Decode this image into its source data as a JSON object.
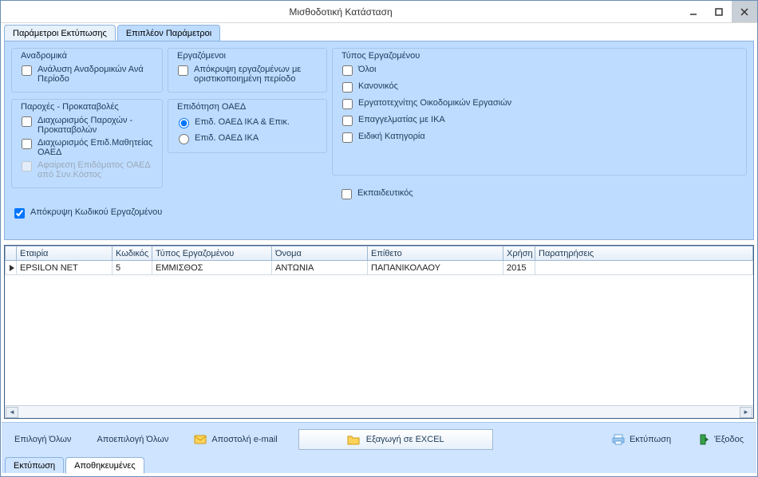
{
  "window": {
    "title": "Μισθοδοτική Κατάσταση"
  },
  "topTabs": {
    "t1": "Παράμετροι Εκτύπωσης",
    "t2": "Επιπλέον Παράμετροι"
  },
  "sections": {
    "anadromika": {
      "legend": "Αναδρομικά",
      "analysisPerPeriod": "Ανάλυση Αναδρομικών Ανά Περίοδο"
    },
    "paroxes": {
      "legend": "Παροχές - Προκαταβολές",
      "separationParoxon": "Διαχωρισμός Παροχών - Προκαταβολών",
      "separationOAED": "Διαχωρισμός Επιδ.Μαθητείας ΟΑΕΔ",
      "removeOAED": "Αφαίρεση Επιδόματος ΟΑΕΔ από Συν.Κόστος"
    },
    "hideCode": "Απόκρυψη Κωδικού Εργαζομένου",
    "ergazomenoi": {
      "legend": "Εργαζόμενοι",
      "hideFinalized": "Απόκρυψη εργαζομένων με οριστικοποιημένη περίοδο"
    },
    "epidotisi": {
      "legend": "Επιδότηση ΟΑΕΔ",
      "r1": "Επιδ. ΟΑΕΔ ΙΚΑ & Επικ.",
      "r2": "Επιδ. ΟΑΕΔ ΙΚΑ"
    },
    "typos": {
      "legend": "Τύπος Εργαζομένου",
      "all": "Όλοι",
      "kanonikos": "Κανονικός",
      "oikodomikon": "Εργατοτεχνίτης Οικοδομικών Εργασιών",
      "epangelmatias": "Επαγγελματίας με ΙΚΑ",
      "eidiki": "Ειδική Κατηγορία",
      "ekpaideutikos": "Εκπαιδευτικός"
    }
  },
  "grid": {
    "headers": {
      "company": "Εταιρία",
      "code": "Κωδικός",
      "type": "Τύπος Εργαζομένου",
      "name": "Όνομα",
      "surname": "Επίθετο",
      "year": "Χρήση",
      "notes": "Παρατηρήσεις"
    },
    "row": {
      "company": "EPSILON NET",
      "code": "5",
      "type": "ΕΜΜΙΣΘΟΣ",
      "name": "ΑΝΤΩΝΙΑ",
      "surname": "ΠΑΠΑΝΙΚΟΛΑΟΥ",
      "year": "2015",
      "notes": ""
    }
  },
  "footer": {
    "selectAll": "Επιλογή Όλων",
    "deselectAll": "Αποεπιλογή Όλων",
    "sendEmail": "Αποστολή e-mail",
    "exportExcel": "Εξαγωγή σε EXCEL",
    "print": "Εκτύπωση",
    "exit": "Έξοδος"
  },
  "bottomTabs": {
    "t1": "Εκτύπωση",
    "t2": "Αποθηκευμένες"
  }
}
